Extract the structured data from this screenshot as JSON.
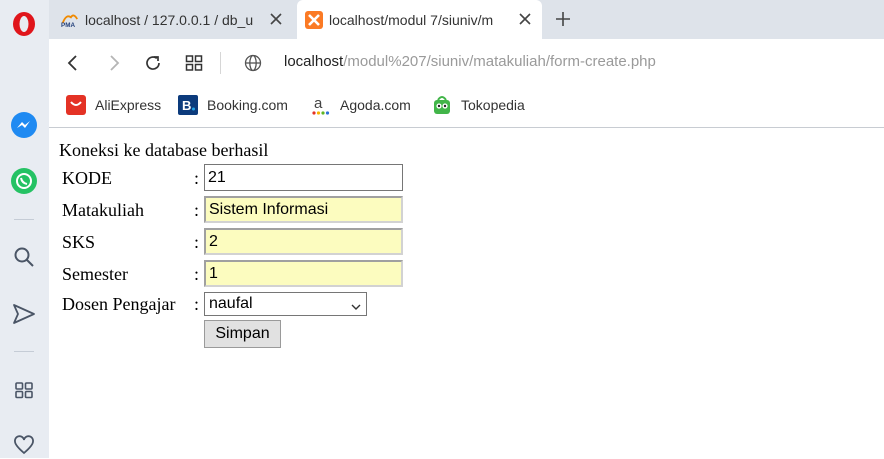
{
  "browser": {
    "tabs": [
      {
        "title": "localhost / 127.0.0.1 / db_u",
        "favicon": "phpmyadmin-icon",
        "active": false
      },
      {
        "title": "localhost/modul 7/siuniv/m",
        "favicon": "xampp-icon",
        "active": true
      }
    ],
    "address": {
      "host": "localhost",
      "path": "/modul%207/siuniv/matakuliah/form-create.php"
    },
    "bookmarks": [
      {
        "label": "AliExpress",
        "icon": "aliexpress-icon"
      },
      {
        "label": "Booking.com",
        "icon": "booking-icon"
      },
      {
        "label": "Agoda.com",
        "icon": "agoda-icon"
      },
      {
        "label": "Tokopedia",
        "icon": "tokopedia-icon"
      }
    ]
  },
  "page": {
    "status": "Koneksi ke database berhasil",
    "colon": ":",
    "form": {
      "kode": {
        "label": "KODE",
        "value": "21"
      },
      "matakuliah": {
        "label": "Matakuliah",
        "value": "Sistem Informasi"
      },
      "sks": {
        "label": "SKS",
        "value": "2"
      },
      "semester": {
        "label": "Semester",
        "value": "1"
      },
      "dosen": {
        "label": "Dosen Pengajar",
        "selected": "naufal"
      },
      "submit_label": "Simpan"
    }
  },
  "colors": {
    "autofill_bg": "#fcfcbf",
    "sidebar_bg": "#e8ecf2",
    "tabstrip_bg": "#dee3ea",
    "opera_red": "#e0151b",
    "messenger_blue": "#1f8af2",
    "whatsapp_green": "#25c264"
  }
}
